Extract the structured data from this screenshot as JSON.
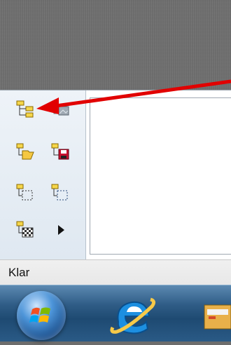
{
  "toolbar": {
    "buttons": [
      {
        "name": "tree-expand-icon"
      },
      {
        "name": "tree-image-icon"
      },
      {
        "name": "tree-open-folder-icon"
      },
      {
        "name": "tree-save-icon"
      },
      {
        "name": "tree-select-icon"
      },
      {
        "name": "tree-select-alt-icon"
      },
      {
        "name": "tree-checker-icon"
      },
      {
        "name": "play-arrow-icon"
      }
    ]
  },
  "status": {
    "text": "Klar"
  },
  "taskbar": {
    "items": [
      "start-orb",
      "internet-explorer-icon",
      "file-explorer-icon"
    ]
  },
  "annotation": {
    "color": "#e10000"
  }
}
